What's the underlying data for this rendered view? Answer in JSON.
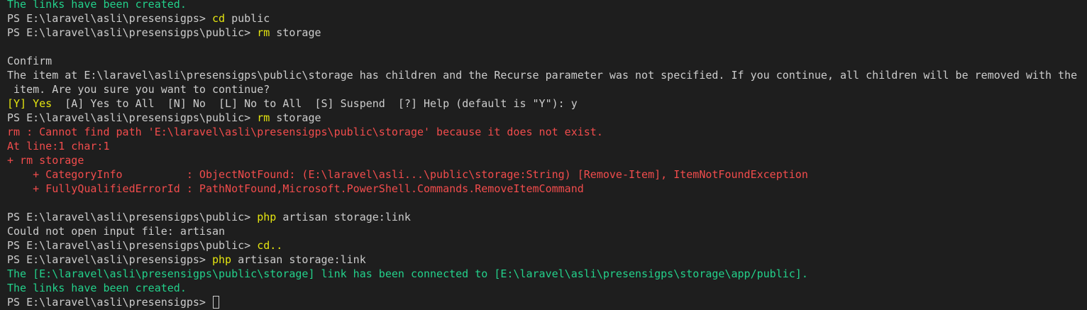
{
  "terminal": {
    "lines": [
      {
        "segments": [
          {
            "text": "The links have been created.",
            "color": "green"
          }
        ]
      },
      {
        "segments": [
          {
            "text": "PS E:\\laravel\\asli\\presensigps> ",
            "color": "white"
          },
          {
            "text": "cd",
            "color": "yellow"
          },
          {
            "text": " public",
            "color": "white"
          }
        ]
      },
      {
        "segments": [
          {
            "text": "PS E:\\laravel\\asli\\presensigps\\public> ",
            "color": "white"
          },
          {
            "text": "rm",
            "color": "yellow"
          },
          {
            "text": " storage",
            "color": "white"
          }
        ]
      },
      {
        "segments": [
          {
            "text": "",
            "color": "white"
          }
        ]
      },
      {
        "segments": [
          {
            "text": "Confirm",
            "color": "white"
          }
        ]
      },
      {
        "segments": [
          {
            "text": "The item at E:\\laravel\\asli\\presensigps\\public\\storage has children and the Recurse parameter was not specified. If you continue, all children will be removed with the",
            "color": "white"
          }
        ]
      },
      {
        "segments": [
          {
            "text": " item. Are you sure you want to continue?",
            "color": "white"
          }
        ]
      },
      {
        "segments": [
          {
            "text": "[Y] Yes",
            "color": "yellow"
          },
          {
            "text": "  [A] Yes to All  [N] No  [L] No to All  [S] Suspend  [?] Help (default is \"Y\"): y",
            "color": "white"
          }
        ]
      },
      {
        "segments": [
          {
            "text": "PS E:\\laravel\\asli\\presensigps\\public> ",
            "color": "white"
          },
          {
            "text": "rm",
            "color": "yellow"
          },
          {
            "text": " storage",
            "color": "white"
          }
        ]
      },
      {
        "segments": [
          {
            "text": "rm : Cannot find path 'E:\\laravel\\asli\\presensigps\\public\\storage' because it does not exist.",
            "color": "red"
          }
        ]
      },
      {
        "segments": [
          {
            "text": "At line:1 char:1",
            "color": "red"
          }
        ]
      },
      {
        "segments": [
          {
            "text": "+ rm storage",
            "color": "red"
          }
        ]
      },
      {
        "segments": [
          {
            "text": "    + CategoryInfo          : ObjectNotFound: (E:\\laravel\\asli...\\public\\storage:String) [Remove-Item], ItemNotFoundException",
            "color": "red"
          }
        ]
      },
      {
        "segments": [
          {
            "text": "    + FullyQualifiedErrorId : PathNotFound,Microsoft.PowerShell.Commands.RemoveItemCommand",
            "color": "red"
          }
        ]
      },
      {
        "segments": [
          {
            "text": "",
            "color": "white"
          }
        ]
      },
      {
        "segments": [
          {
            "text": "PS E:\\laravel\\asli\\presensigps\\public> ",
            "color": "white"
          },
          {
            "text": "php",
            "color": "yellow"
          },
          {
            "text": " artisan storage:link",
            "color": "white"
          }
        ]
      },
      {
        "segments": [
          {
            "text": "Could not open input file: artisan",
            "color": "white"
          }
        ]
      },
      {
        "segments": [
          {
            "text": "PS E:\\laravel\\asli\\presensigps\\public> ",
            "color": "white"
          },
          {
            "text": "cd..",
            "color": "yellow"
          }
        ]
      },
      {
        "segments": [
          {
            "text": "PS E:\\laravel\\asli\\presensigps> ",
            "color": "white"
          },
          {
            "text": "php",
            "color": "yellow"
          },
          {
            "text": " artisan storage:link",
            "color": "white"
          }
        ]
      },
      {
        "segments": [
          {
            "text": "The [E:\\laravel\\asli\\presensigps\\public\\storage] link has been connected to [E:\\laravel\\asli\\presensigps\\storage\\app/public].",
            "color": "green"
          }
        ]
      },
      {
        "segments": [
          {
            "text": "The links have been created.",
            "color": "green"
          }
        ]
      },
      {
        "segments": [
          {
            "text": "PS E:\\laravel\\asli\\presensigps> ",
            "color": "white"
          }
        ],
        "cursor": true
      }
    ]
  }
}
